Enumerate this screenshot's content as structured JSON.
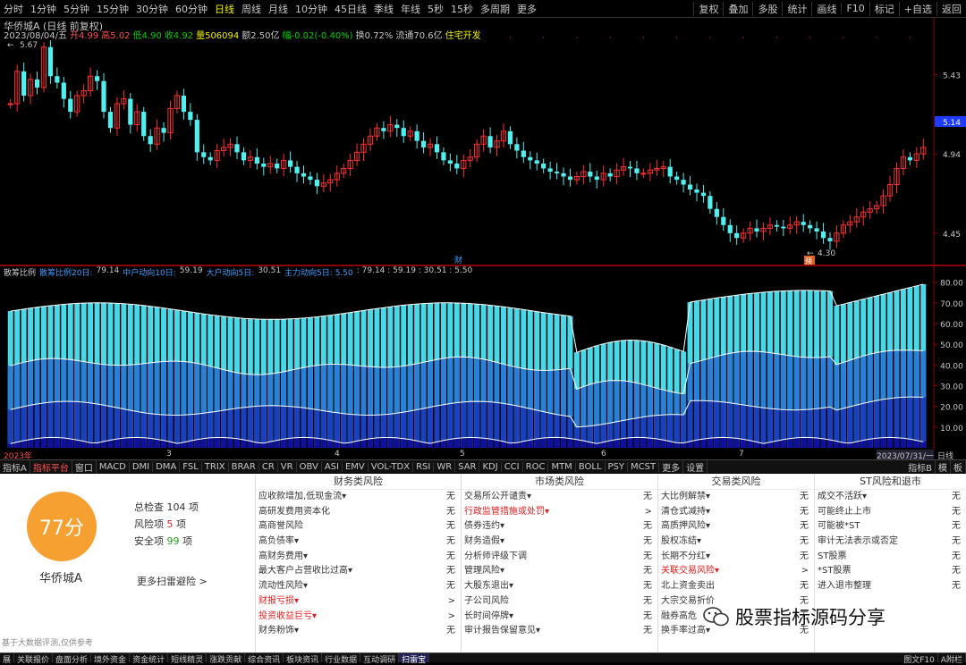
{
  "periods": [
    "分时",
    "1分钟",
    "5分钟",
    "15分钟",
    "30分钟",
    "60分钟",
    "日线",
    "周线",
    "月线",
    "10分钟",
    "45日线",
    "季线",
    "年线",
    "5秒",
    "15秒",
    "多周期",
    "更多"
  ],
  "active_period": "日线",
  "top_right": [
    "复权",
    "叠加",
    "多股",
    "统计",
    "画线",
    "F10",
    "标记",
    "+自选",
    "返回"
  ],
  "stock_title": "华侨城A (日线 前复权)",
  "date_line": "2023/08/04/五",
  "quote": [
    {
      "t": "开4.99",
      "c": "#ff5050"
    },
    {
      "t": "高5.02",
      "c": "#ff5050"
    },
    {
      "t": "低4.90",
      "c": "#00d000"
    },
    {
      "t": "收4.92",
      "c": "#00d000"
    },
    {
      "t": "量506094",
      "c": "#f0f000"
    },
    {
      "t": "额2.50亿",
      "c": "#c8c8c8"
    },
    {
      "t": "幅-0.02(-0.40%)",
      "c": "#00d000"
    },
    {
      "t": "换0.72%",
      "c": "#c8c8c8"
    },
    {
      "t": "流通70.6亿",
      "c": "#c8c8c8"
    },
    {
      "t": "住宅开发",
      "c": "#f0f000"
    }
  ],
  "price_axis": [
    "5.43",
    "5.14",
    "4.94",
    "4.45"
  ],
  "current_price": "5.14",
  "hi_label": "5.67",
  "lo_label": "4.30",
  "cai_label": "财",
  "zhi_label": "预",
  "vol_header": [
    {
      "t": "散筹比例",
      "c": "#c8c8c8"
    },
    {
      "t": "散筹比例20日:",
      "c": "#3aa0ff"
    },
    {
      "t": "79.14",
      "c": "#c8c8c8"
    },
    {
      "t": "中户动向10日:",
      "c": "#3aa0ff"
    },
    {
      "t": "59.19",
      "c": "#c8c8c8"
    },
    {
      "t": "大户动向5日:",
      "c": "#3aa0ff"
    },
    {
      "t": "30.51",
      "c": "#c8c8c8"
    },
    {
      "t": "主力动向5日: 5.50",
      "c": "#3aa0ff"
    },
    {
      "t": ": 79.14 : 59.19 : 30.51 : 5.50",
      "c": "#c8c8c8"
    }
  ],
  "ind_axis": [
    "80.00",
    "70.00",
    "60.00",
    "50.00",
    "40.00",
    "30.00",
    "20.00",
    "10.00"
  ],
  "date_marks": {
    "start": "2023年",
    "m3": "3",
    "m4": "4",
    "m5": "5",
    "m6": "6",
    "m7": "7",
    "end": "2023/07/31/一"
  },
  "day_btn": "日线",
  "tabs": [
    "指标A",
    "指标平台",
    "窗口",
    "MACD",
    "DMI",
    "DMA",
    "FSL",
    "TRIX",
    "BRAR",
    "CR",
    "VR",
    "OBV",
    "ASI",
    "EMV",
    "VOL-TDX",
    "RSI",
    "WR",
    "SAR",
    "KDJ",
    "CCI",
    "ROC",
    "MTM",
    "BOLL",
    "PSY",
    "MCST",
    "更多",
    "设置"
  ],
  "tabs_right": [
    "指标B",
    "模",
    "板"
  ],
  "risk": {
    "score": "77分",
    "name": "华侨城A",
    "total_label": "总检查",
    "total": "104",
    "total_unit": "项",
    "risk_label": "风险项",
    "risk_n": "5",
    "risk_unit": "项",
    "safe_label": "安全项",
    "safe_n": "99",
    "safe_unit": "项",
    "more": "更多扫雷避险 >",
    "footnote": "基于大数据评测,仅供参考",
    "cols": [
      {
        "title": "财务类风险",
        "rows": [
          {
            "l": "应收款增加,低现金流▾",
            "v": "无",
            "red": false
          },
          {
            "l": "高研发费用资本化",
            "v": "无",
            "red": false
          },
          {
            "l": "高商誉风险",
            "v": "无",
            "red": false
          },
          {
            "l": "高负债率▾",
            "v": "无",
            "red": false
          },
          {
            "l": "高财务费用▾",
            "v": "无",
            "red": false
          },
          {
            "l": "最大客户占营收比过高▾",
            "v": "无",
            "red": false
          },
          {
            "l": "流动性风险▾",
            "v": "无",
            "red": false
          },
          {
            "l": "财报亏损▾",
            "v": ">",
            "red": true
          },
          {
            "l": "投资收益巨亏▾",
            "v": ">",
            "red": true
          },
          {
            "l": "财务粉饰▾",
            "v": "无",
            "red": false
          }
        ]
      },
      {
        "title": "市场类风险",
        "rows": [
          {
            "l": "交易所公开谴责▾",
            "v": "无",
            "red": false
          },
          {
            "l": "行政监管措施或处罚▾",
            "v": ">",
            "red": true
          },
          {
            "l": "债券违约▾",
            "v": "无",
            "red": false
          },
          {
            "l": "财务造假▾",
            "v": "无",
            "red": false
          },
          {
            "l": "分析师评级下调",
            "v": "无",
            "red": false
          },
          {
            "l": "管理风险▾",
            "v": "无",
            "red": false
          },
          {
            "l": "大股东退出▾",
            "v": "无",
            "red": false
          },
          {
            "l": "子公司风险",
            "v": "无",
            "red": false
          },
          {
            "l": "长时间停牌▾",
            "v": "无",
            "red": false
          },
          {
            "l": "审计报告保留意见▾",
            "v": "无",
            "red": false
          }
        ]
      },
      {
        "title": "交易类风险",
        "rows": [
          {
            "l": "大比例解禁▾",
            "v": "无",
            "red": false
          },
          {
            "l": "清仓式减持▾",
            "v": "无",
            "red": false
          },
          {
            "l": "高质押风险▾",
            "v": "无",
            "red": false
          },
          {
            "l": "股权冻结▾",
            "v": "无",
            "red": false
          },
          {
            "l": "长期不分红▾",
            "v": "无",
            "red": false
          },
          {
            "l": "关联交易风险▾",
            "v": ">",
            "red": true
          },
          {
            "l": "北上资金卖出",
            "v": "无",
            "red": false
          },
          {
            "l": "大宗交易折价",
            "v": "无",
            "red": false
          },
          {
            "l": "融券高危",
            "v": "无",
            "red": false
          },
          {
            "l": "换手率过高▾",
            "v": "无",
            "red": false
          }
        ]
      },
      {
        "title": "ST风险和退市",
        "rows": [
          {
            "l": "成交不活跃▾",
            "v": "无",
            "red": false
          },
          {
            "l": "可能终止上市",
            "v": "无",
            "red": false
          },
          {
            "l": "可能被*ST",
            "v": "无",
            "red": false
          },
          {
            "l": "审计无法表示或否定",
            "v": "无",
            "red": false
          },
          {
            "l": "ST股票",
            "v": "无",
            "red": false
          },
          {
            "l": "*ST股票",
            "v": "无",
            "red": false
          },
          {
            "l": "进入退市整理",
            "v": "无",
            "red": false
          }
        ]
      }
    ]
  },
  "watermark": "股票指标源码分享",
  "bottom": [
    "展",
    "关联报价",
    "盘面分析",
    "境外资金",
    "资金统计",
    "短线精灵",
    "涨跌贡献",
    "综合资讯",
    "板块资讯",
    "行业数据",
    "互动调研",
    "扫雷宝"
  ],
  "bottom_sel": "扫雷宝",
  "bottom_right": "图文F10 ",
  "bottom_right2": "A附栏",
  "colors": {
    "up": "#ff3030",
    "down": "#50f0f0",
    "axis": "#c8c8c8",
    "grid": "#8b0000"
  },
  "candles": [
    5.25,
    5.45,
    5.3,
    5.4,
    5.35,
    5.6,
    5.42,
    5.38,
    5.28,
    5.2,
    5.3,
    5.33,
    5.42,
    5.39,
    5.2,
    5.1,
    5.25,
    5.28,
    5.12,
    5.2,
    5.05,
    5.0,
    5.1,
    5.07,
    5.22,
    5.3,
    5.2,
    5.15,
    4.95,
    4.92,
    4.9,
    4.96,
    4.98,
    5.0,
    4.95,
    4.9,
    4.92,
    4.88,
    4.86,
    4.88,
    4.85,
    4.9,
    4.86,
    4.82,
    4.8,
    4.78,
    4.74,
    4.76,
    4.78,
    4.82,
    4.85,
    4.9,
    4.95,
    5.0,
    5.05,
    5.1,
    5.08,
    5.12,
    5.1,
    5.05,
    5.08,
    5.02,
    4.98,
    5.0,
    4.95,
    4.9,
    4.88,
    4.85,
    4.9,
    4.92,
    5.0,
    5.05,
    4.98,
    5.02,
    5.08,
    5.0,
    4.96,
    4.92,
    4.9,
    4.88,
    4.85,
    4.83,
    4.82,
    4.8,
    4.78,
    4.8,
    4.83,
    4.8,
    4.78,
    4.82,
    4.8,
    4.84,
    4.86,
    4.85,
    4.82,
    4.82,
    4.84,
    4.85,
    4.86,
    4.8,
    4.78,
    4.75,
    4.72,
    4.7,
    4.68,
    4.6,
    4.55,
    4.5,
    4.45,
    4.42,
    4.45,
    4.48,
    4.46,
    4.48,
    4.5,
    4.49,
    4.48,
    4.5,
    4.52,
    4.5,
    4.48,
    4.46,
    4.42,
    4.4,
    4.45,
    4.5,
    4.52,
    4.55,
    4.58,
    4.6,
    4.62,
    4.68,
    4.75,
    4.85,
    4.92,
    4.9,
    4.94,
    4.98
  ]
}
